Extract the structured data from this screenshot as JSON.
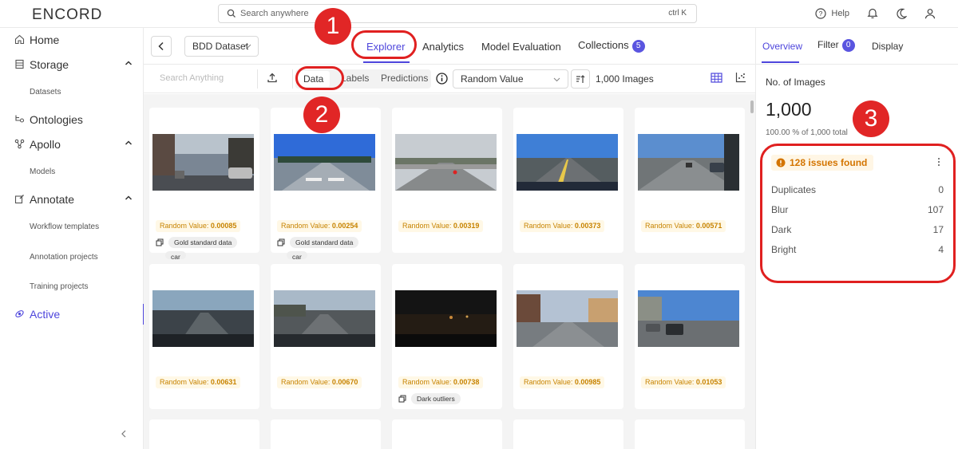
{
  "app": {
    "logo": "ENCORD"
  },
  "search": {
    "placeholder": "Search anywhere",
    "shortcut": "ctrl K"
  },
  "topbar": {
    "help_label": "Help"
  },
  "sidebar": {
    "items": [
      {
        "label": "Home"
      },
      {
        "label": "Storage"
      },
      {
        "sub": "Datasets"
      },
      {
        "label": "Ontologies"
      },
      {
        "label": "Apollo"
      },
      {
        "sub": "Models"
      },
      {
        "label": "Annotate"
      },
      {
        "sub": "Workflow templates"
      },
      {
        "sub": "Annotation projects"
      },
      {
        "sub": "Training projects"
      },
      {
        "label": "Active"
      }
    ]
  },
  "header": {
    "dataset": "BDD Dataset",
    "tabs": [
      {
        "label": "Explorer"
      },
      {
        "label": "Analytics"
      },
      {
        "label": "Model Evaluation"
      },
      {
        "label": "Collections",
        "badge": "5"
      }
    ]
  },
  "toolbar": {
    "search_placeholder": "Search Anything",
    "segments": [
      "Data",
      "Labels",
      "Predictions"
    ],
    "sort_value": "Random Value",
    "count": "1,000 Images"
  },
  "cards": [
    {
      "label": "Random Value: ",
      "value": "0.00085",
      "tag": "Gold standard data",
      "tag2": "car",
      "scene": "city-left"
    },
    {
      "label": "Random Value: ",
      "value": "0.00254",
      "tag": "Gold standard data",
      "tag2": "car",
      "scene": "bluesky-road"
    },
    {
      "label": "Random Value: ",
      "value": "0.00319",
      "scene": "highway-cloud"
    },
    {
      "label": "Random Value: ",
      "value": "0.00373",
      "scene": "highway-blue"
    },
    {
      "label": "Random Value: ",
      "value": "0.00571",
      "scene": "road-cars"
    },
    {
      "label": "Random Value: ",
      "value": "0.00631",
      "scene": "dark-road"
    },
    {
      "label": "Random Value: ",
      "value": "0.00670",
      "scene": "intersection"
    },
    {
      "label": "Random Value: ",
      "value": "0.00738",
      "tag": "Dark outliers",
      "scene": "night"
    },
    {
      "label": "Random Value: ",
      "value": "0.00985",
      "scene": "city-buildings"
    },
    {
      "label": "Random Value: ",
      "value": "0.01053",
      "scene": "city-blue"
    }
  ],
  "right_panel": {
    "tabs": [
      {
        "label": "Overview"
      },
      {
        "label": "Filter",
        "badge": "0"
      },
      {
        "label": "Display"
      }
    ],
    "images_label": "No. of Images",
    "images_value": "1,000",
    "images_pct": "100.00 % of 1,000 total",
    "issues_title": "128 issues found",
    "issues": [
      {
        "name": "Duplicates",
        "value": "0"
      },
      {
        "name": "Blur",
        "value": "107"
      },
      {
        "name": "Dark",
        "value": "17"
      },
      {
        "name": "Bright",
        "value": "4"
      }
    ]
  },
  "annotations": {
    "m1": "1",
    "m2": "2",
    "m3": "3"
  },
  "colors": {
    "accent": "#4e46dc",
    "annotation": "#e02020",
    "warning": "#d47500"
  }
}
